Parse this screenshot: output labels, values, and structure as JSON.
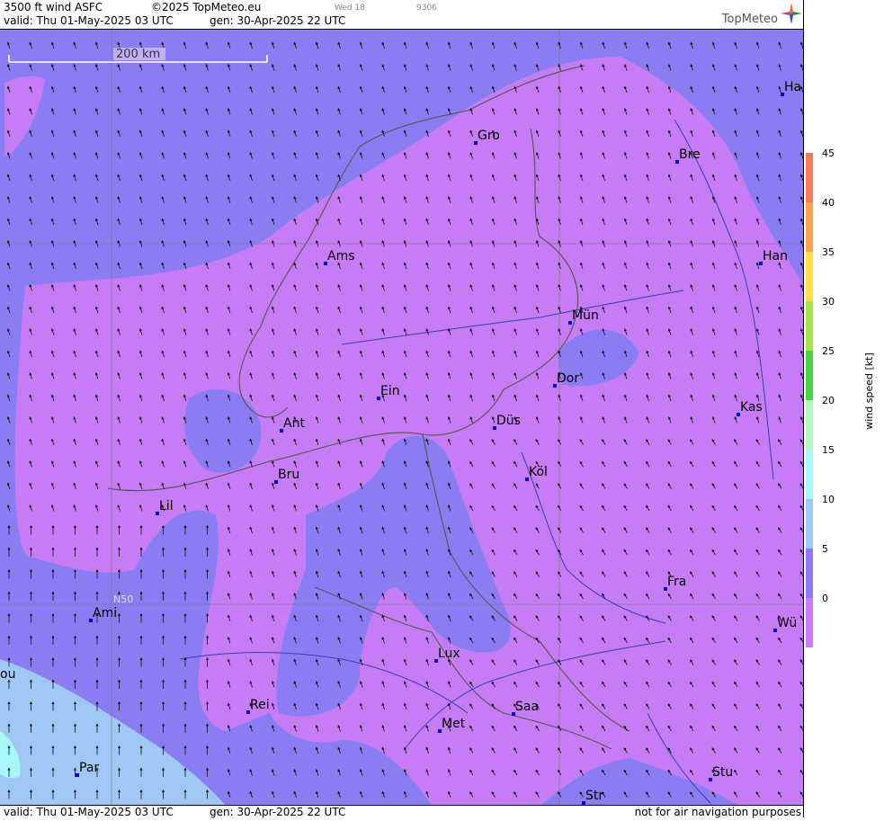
{
  "header": {
    "product": "3500 ft wind ASFC",
    "copyright": "©2025 TopMeteo.eu",
    "day": "Wed 18",
    "code": "9306",
    "valid": "valid:  Thu  01-May-2025  03 UTC",
    "generated": "gen: 30-Apr-2025 22 UTC",
    "brand": "TopMeteo"
  },
  "footer": {
    "valid": "valid:  Thu  01-May-2025  03 UTC",
    "generated": "gen: 30-Apr-2025 22 UTC",
    "disclaimer": "not for air navigation purposes"
  },
  "map": {
    "scale_label": "200 km",
    "lat_label": "N50",
    "cities": [
      "Ha",
      "Gro",
      "Bre",
      "Ams",
      "Han",
      "Mün",
      "Ein",
      "Dor",
      "Ant",
      "Düs",
      "Kas",
      "Bru",
      "Köl",
      "Lil",
      "Fra",
      "Ami",
      "Wü",
      "ou",
      "Lux",
      "Rei",
      "Saa",
      "Met",
      "Par",
      "Stu",
      "Str"
    ]
  },
  "legend": {
    "title": "wind  speed  [kt]",
    "ticks": [
      "45",
      "40",
      "35",
      "30",
      "25",
      "20",
      "15",
      "10",
      "5",
      "0"
    ],
    "colors": [
      "#f47a62",
      "#f8a451",
      "#fde04c",
      "#a4e34a",
      "#48d24b",
      "#b6f4c4",
      "#a6f7f8",
      "#a1c8f4",
      "#8a7df4",
      "#c57cf4"
    ]
  },
  "colors": {
    "calm": "#c57cf4",
    "light": "#8a7df4",
    "moderate": "#a1c8f4",
    "strong": "#a6f7f8",
    "border": "#555555",
    "river": "#2233aa",
    "city_marker": "#0000cc"
  }
}
